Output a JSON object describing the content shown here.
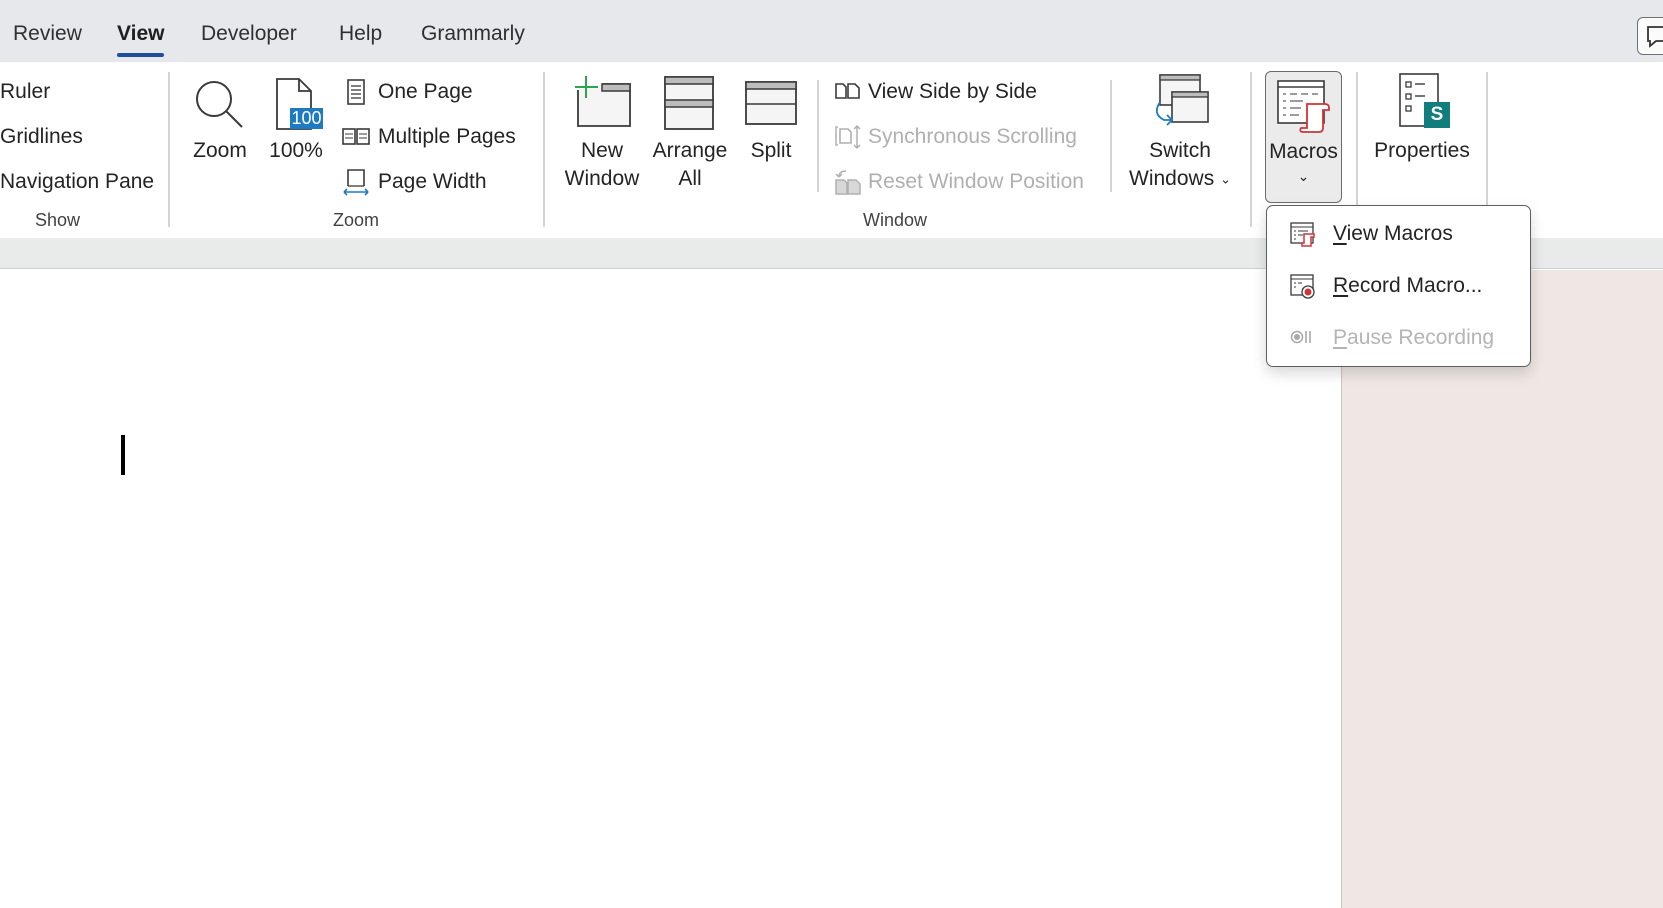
{
  "tabs": [
    {
      "label": "Review",
      "active": false
    },
    {
      "label": "View",
      "active": true
    },
    {
      "label": "Developer",
      "active": false
    },
    {
      "label": "Help",
      "active": false
    },
    {
      "label": "Grammarly",
      "active": false
    }
  ],
  "comment_button": {
    "icon": "comment-icon"
  },
  "ribbon": {
    "show": {
      "label": "Show",
      "items": [
        "Ruler",
        "Gridlines",
        "Navigation Pane"
      ]
    },
    "zoom": {
      "label": "Zoom",
      "zoom_button": "Zoom",
      "hundred_button": "100%",
      "hundred_badge": "100",
      "one_page": "One Page",
      "multiple_pages": "Multiple Pages",
      "page_width": "Page Width"
    },
    "window": {
      "label": "Window",
      "new_window": [
        "New",
        "Window"
      ],
      "arrange_all": [
        "Arrange",
        "All"
      ],
      "split": "Split",
      "view_side_by_side": "View Side by Side",
      "synchronous_scrolling": "Synchronous Scrolling",
      "reset_window_position": "Reset Window Position",
      "switch_windows": [
        "Switch",
        "Windows"
      ]
    },
    "macros": {
      "label": "Macros"
    },
    "properties": {
      "label": "Properties",
      "badge": "S"
    }
  },
  "macros_menu": {
    "items": [
      {
        "accel": "V",
        "rest": "iew Macros",
        "enabled": true,
        "icon": "view-macros-icon"
      },
      {
        "accel": "R",
        "rest": "ecord Macro...",
        "enabled": true,
        "icon": "record-macro-icon"
      },
      {
        "accel": "P",
        "rest": "ause Recording",
        "enabled": false,
        "icon": "pause-recording-icon"
      }
    ]
  },
  "colors": {
    "active_tab_underline": "#1e4e9c",
    "accent_blue": "#1f7bc1",
    "macro_red": "#d13438",
    "new_window_green": "#2ea44f",
    "properties_teal": "#127d7d"
  }
}
